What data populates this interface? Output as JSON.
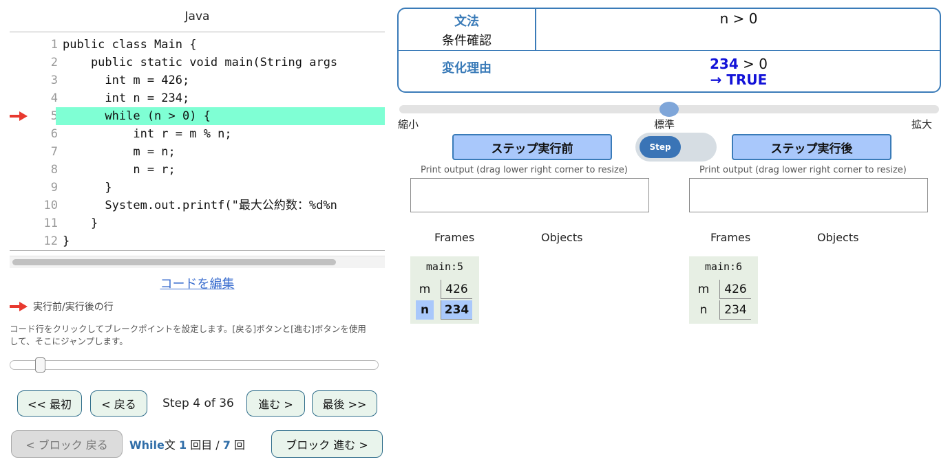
{
  "code_panel": {
    "language": "Java",
    "current_line_index": 4,
    "lines": [
      {
        "num": "1",
        "text": "public class Main {"
      },
      {
        "num": "2",
        "text": "    public static void main(String args"
      },
      {
        "num": "3",
        "text": "      int m = 426;"
      },
      {
        "num": "4",
        "text": "      int n = 234;"
      },
      {
        "num": "5",
        "text": "      while (n > 0) {"
      },
      {
        "num": "6",
        "text": "          int r = m % n;"
      },
      {
        "num": "7",
        "text": "          m = n;"
      },
      {
        "num": "8",
        "text": "          n = r;"
      },
      {
        "num": "9",
        "text": "      }"
      },
      {
        "num": "10",
        "text": "      System.out.printf(\"最大公約数：%d%n"
      },
      {
        "num": "11",
        "text": "    }"
      },
      {
        "num": "12",
        "text": "}"
      }
    ],
    "edit_link": "コードを編集",
    "legend": "実行前/実行後の行",
    "help": "コード行をクリックしてブレークポイントを設定します。[戻る]ボタンと[進む]ボタンを使用して、そこにジャンプします。",
    "arrow_color": "#e8392f",
    "highlight_color": "#7fffd4"
  },
  "navigation": {
    "first": "<< 最初",
    "back": "< 戻る",
    "step_text": "Step 4 of 36",
    "forward": "進む >",
    "last": "最後 >>",
    "block_back": "< ブロック 戻る",
    "block_forward": "ブロック 進む >",
    "loop_keyword": "While",
    "loop_suffix": "文",
    "loop_current": "1",
    "loop_mid": "回目 /",
    "loop_total": "7",
    "loop_unit": "回",
    "step_slider_fraction": 0.083
  },
  "explanation": {
    "grammar_label": "文法",
    "grammar_value": "条件確認",
    "condition": "n > 0",
    "reason_label": "変化理由",
    "reason_value": "234",
    "reason_rest": "> 0",
    "reason_result": "→ TRUE",
    "accent_color": "#3a7bb8"
  },
  "zoom": {
    "min_label": "縮小",
    "mid_label": "標準",
    "max_label": "拡大",
    "level": 0.5
  },
  "step_controls": {
    "before_button": "ステップ実行前",
    "toggle_label": "Step",
    "after_button": "ステップ実行後"
  },
  "before_view": {
    "print_label": "Print output (drag lower right corner to resize)",
    "frames_header": "Frames",
    "objects_header": "Objects",
    "frame_name": "main:5",
    "vars": [
      {
        "name": "m",
        "value": "426",
        "changed": false
      },
      {
        "name": "n",
        "value": "234",
        "changed": true
      }
    ]
  },
  "after_view": {
    "print_label": "Print output (drag lower right corner to resize)",
    "frames_header": "Frames",
    "objects_header": "Objects",
    "frame_name": "main:6",
    "vars": [
      {
        "name": "m",
        "value": "426",
        "changed": false
      },
      {
        "name": "n",
        "value": "234",
        "changed": false
      }
    ]
  }
}
